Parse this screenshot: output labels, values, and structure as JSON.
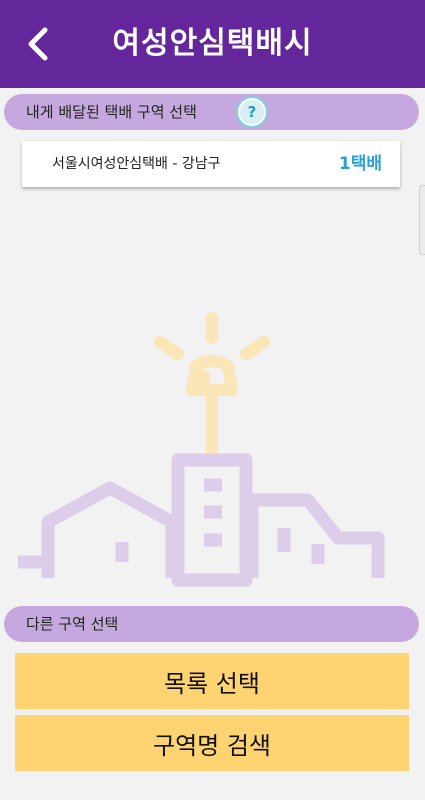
{
  "header": {
    "title": "여성안심택배시",
    "back_icon": "chevron-left-icon"
  },
  "my_section": {
    "label": "내게 배달된 택배 구역 선택",
    "help_icon": "question-icon",
    "help_glyph": "?"
  },
  "region": {
    "name": "서울시여성안심택배 - 강남구",
    "count": "1택배"
  },
  "other_section": {
    "label": "다른 구역 선택"
  },
  "buttons": {
    "list_select": "목록 선택",
    "region_search": "구역명 검색"
  },
  "illustration": {
    "name": "city-lighthouse-illustration",
    "colors": {
      "light": "#fbe6b8",
      "city": "#dccdea"
    }
  },
  "colors": {
    "header_bg": "#63279b",
    "section_bg": "#c5a9de",
    "count_text": "#2a9fd8",
    "button_bg": "#fed472"
  }
}
